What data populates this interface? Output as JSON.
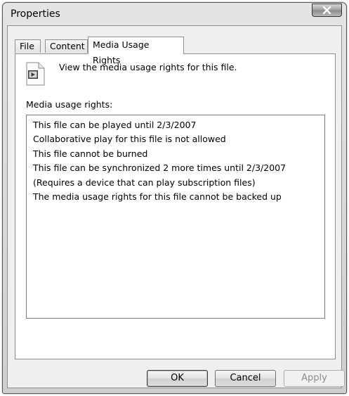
{
  "window": {
    "title": "Properties",
    "close_icon": "close-x-icon"
  },
  "tabs": [
    {
      "label": "File",
      "active": false
    },
    {
      "label": "Content",
      "active": false
    },
    {
      "label": "Media Usage Rights",
      "active": true
    }
  ],
  "panel": {
    "icon": "media-document-icon",
    "description": "View the media usage rights for this file.",
    "rights_label": "Media usage rights:",
    "rights": [
      "This file can be played until 2/3/2007",
      "Collaborative play for this file is not allowed",
      "This file cannot be burned",
      "This file can be synchronized 2 more times until 2/3/2007",
      "(Requires a device that can play subscription files)",
      "The media usage rights for this file cannot be backed up"
    ]
  },
  "buttons": {
    "ok": "OK",
    "cancel": "Cancel",
    "apply": "Apply",
    "apply_enabled": false
  }
}
